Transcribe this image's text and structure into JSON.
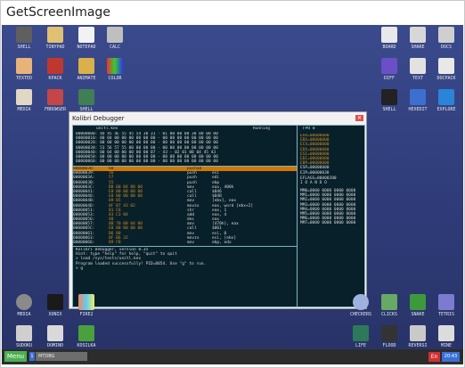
{
  "window": {
    "title": "GetScreenImage"
  },
  "desktop_icons": {
    "left_top": [
      {
        "label": "SHELL"
      },
      {
        "label": "TINYPAD"
      },
      {
        "label": "NOTEPAD"
      },
      {
        "label": "CALC"
      },
      {
        "label": "TEXTED"
      },
      {
        "label": "KPACK"
      },
      {
        "label": "ANIMATE"
      },
      {
        "label": "COLOR"
      },
      {
        "label": "MEDIA"
      },
      {
        "label": "FBROWSER"
      },
      {
        "label": "SHELL"
      }
    ],
    "right_top": [
      {
        "label": "BOARD"
      },
      {
        "label": "SHARE"
      },
      {
        "label": "DOCS"
      },
      {
        "label": "DIFF"
      },
      {
        "label": "TEXT"
      },
      {
        "label": "DOCPACK"
      },
      {
        "label": "SHELL"
      },
      {
        "label": "HEXEDIT"
      },
      {
        "label": "EXPLORE"
      }
    ],
    "left_bottom": [
      {
        "label": "MEDIA"
      },
      {
        "label": "XONIX"
      },
      {
        "label": "FIRE2"
      },
      {
        "label": "SUDOKU"
      },
      {
        "label": "DOMINO"
      },
      {
        "label": "KOSILKA"
      }
    ],
    "right_bottom": [
      {
        "label": "CHECKERS"
      },
      {
        "label": "CLICKS"
      },
      {
        "label": "SNAKE"
      },
      {
        "label": "TETRIS"
      },
      {
        "label": "LIFE"
      },
      {
        "label": "FLOOD"
      },
      {
        "label": "REVERSI"
      },
      {
        "label": "MINE"
      }
    ]
  },
  "debugger": {
    "title": "Kolibri Debugger",
    "status": "Running",
    "file": "unitl.kex",
    "fpu_tab": "FPU 0",
    "hex_rows": [
      "00000000: 4D 45 4E 55 45 54 30 31 - 01 00 00 00 38 00 00 00",
      "00000010: 00 04 00 00 00 00 00 00 - 00 00 00 00 00 00 00 00",
      "00000020: 00 00 00 00 00 00 00 00 - 00 00 00 00 00 00 00 00",
      "00000030: 53 56 57 55 00 00 00 00 - 00 00 00 00 00 00 00 00",
      "00000040: 00 04 00 00 00 00 00 07 - 43 - 02 01 08 04 45 43",
      "00000050: 00 00 00 00 00 00 00 00 - 00 00 00 00 00 00 00 00",
      "00000060: 00 00 00 00 00 00 00 00 - 00 00 00 00 00 00 00 00"
    ],
    "disasm_rows": [
      {
        "addr": "00000038:",
        "bytes": "60",
        "mn": "pushad",
        "op": "",
        "hl": true
      },
      {
        "addr": "00000039:",
        "bytes": "56",
        "mn": "push",
        "op": "esi",
        "hl": false
      },
      {
        "addr": "0000003A:",
        "bytes": "57",
        "mn": "push",
        "op": "edi",
        "hl": false
      },
      {
        "addr": "0000003B:",
        "bytes": "55",
        "mn": "push",
        "op": "ebp",
        "hl": false
      },
      {
        "addr": "0000003C:",
        "bytes": "B8 00 04 00 00",
        "mn": "mov",
        "op": "eax, 400h",
        "hl": false
      },
      {
        "addr": "00000041:",
        "bytes": "E8 00 00 00 00",
        "mn": "call",
        "op": "$046",
        "hl": false
      },
      {
        "addr": "00000046:",
        "bytes": "E8 00 00 00 00",
        "mn": "call",
        "op": "$04B",
        "hl": false
      },
      {
        "addr": "0000004B:",
        "bytes": "89 05",
        "mn": "mov",
        "op": "[ebx], eax",
        "hl": false
      },
      {
        "addr": "0000004D:",
        "bytes": "0F B7 43 02",
        "mn": "movzx",
        "op": "eax, word [ebx+2]",
        "hl": false
      },
      {
        "addr": "00000051:",
        "bytes": "01 C6",
        "mn": "shr",
        "op": "eax, 1",
        "hl": false
      },
      {
        "addr": "00000053:",
        "bytes": "83 C3 04",
        "mn": "add",
        "op": "eax, 4",
        "hl": false
      },
      {
        "addr": "00000056:",
        "bytes": "48",
        "mn": "dec",
        "op": "eax",
        "hl": false
      },
      {
        "addr": "00000057:",
        "bytes": "8B 70 00 04 00",
        "mn": "mov",
        "op": "[470h], eax",
        "hl": false
      },
      {
        "addr": "0000005C:",
        "bytes": "E8 00 00 00 00",
        "mn": "call",
        "op": "$061",
        "hl": false
      },
      {
        "addr": "00000061:",
        "bytes": "B6 80",
        "mn": "mov",
        "op": "esi, 0",
        "hl": false
      },
      {
        "addr": "00000063:",
        "bytes": "0F B6 32",
        "mn": "movzx",
        "op": "esi, [ebx]",
        "hl": false
      },
      {
        "addr": "00000066:",
        "bytes": "89 FB",
        "mn": "mov",
        "op": "ebp, edx",
        "hl": false
      }
    ],
    "registers": [
      "EAX=00000000",
      "EBX=00000000",
      "ECX=00000000",
      "EDX=00000000",
      "ESI=00000000",
      "EDI=00000000",
      "EBP=00000000",
      "ESP=00000000",
      "EIP=00000038",
      "EFLAGS=00000200",
      "I  O  A  N  D  O",
      "MM0=0000 0000 0000 0000",
      "MM1=0000 0000 0000 0000",
      "MM2=0000 0000 0000 0000",
      "MM3=0000 0000 0000 0000",
      "MM4=0000 0000 0000 0000",
      "MM5=0000 0000 0000 0000",
      "MM6=0000 0000 0000 0000",
      "MM7=0000 0000 0000 0000"
    ],
    "console": [
      "Kolibri Debugger, version 0.35",
      "Hint: type \"help\" for help, \"quit\" to quit",
      "> load /sys/tests/unitl.kex",
      "Program loaded successfully! PID=0054. Use \"g\" to run.",
      "> g"
    ]
  },
  "taskbar": {
    "menu_label": "Menu",
    "tray_small": "1",
    "task_label": "MTDBG",
    "lang": "En",
    "time": "20:43"
  },
  "colors": {
    "desktop": "#2f3b78",
    "highlight": "#d07800",
    "menu_green": "#4caf50"
  }
}
